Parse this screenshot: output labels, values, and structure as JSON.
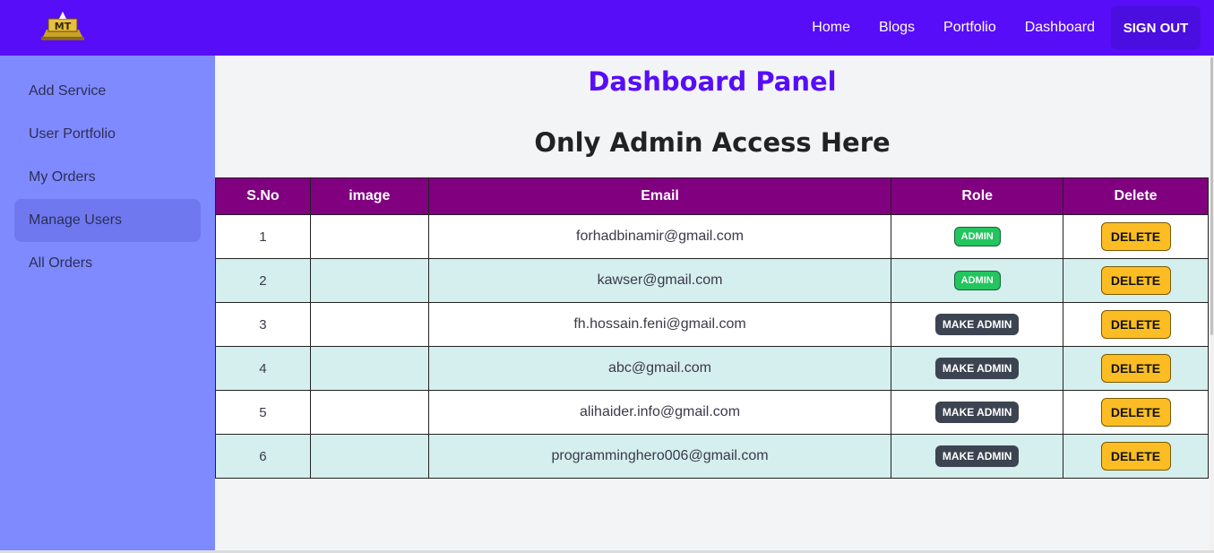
{
  "navbar": {
    "logo_name": "MT logo",
    "links": [
      "Home",
      "Blogs",
      "Portfolio",
      "Dashboard"
    ],
    "signout_label": "SIGN OUT",
    "bg_color": "#570df8"
  },
  "sidebar": {
    "items": [
      {
        "label": "Add Service"
      },
      {
        "label": "User Portfolio"
      },
      {
        "label": "My Orders"
      },
      {
        "label": "Manage Users",
        "active": true
      },
      {
        "label": "All Orders"
      }
    ],
    "bg_color": "#7f8aff"
  },
  "main": {
    "title": "Dashboard Panel",
    "subtitle": "Only Admin Access Here"
  },
  "table": {
    "headers": [
      "S.No",
      "image",
      "Email",
      "Role",
      "Delete"
    ],
    "rows": [
      {
        "sno": "1",
        "email": "forhadbinamir@gmail.com",
        "role": "ADMIN",
        "delete": "DELETE"
      },
      {
        "sno": "2",
        "email": "kawser@gmail.com",
        "role": "ADMIN",
        "delete": "DELETE"
      },
      {
        "sno": "3",
        "email": "fh.hossain.feni@gmail.com",
        "role": "MAKE ADMIN",
        "delete": "DELETE"
      },
      {
        "sno": "4",
        "email": "abc@gmail.com",
        "role": "MAKE ADMIN",
        "delete": "DELETE"
      },
      {
        "sno": "5",
        "email": "alihaider.info@gmail.com",
        "role": "MAKE ADMIN",
        "delete": "DELETE"
      },
      {
        "sno": "6",
        "email": "programminghero006@gmail.com",
        "role": "MAKE ADMIN",
        "delete": "DELETE"
      }
    ],
    "header_color": "#800080",
    "stripe_color": "#d5eeee"
  }
}
